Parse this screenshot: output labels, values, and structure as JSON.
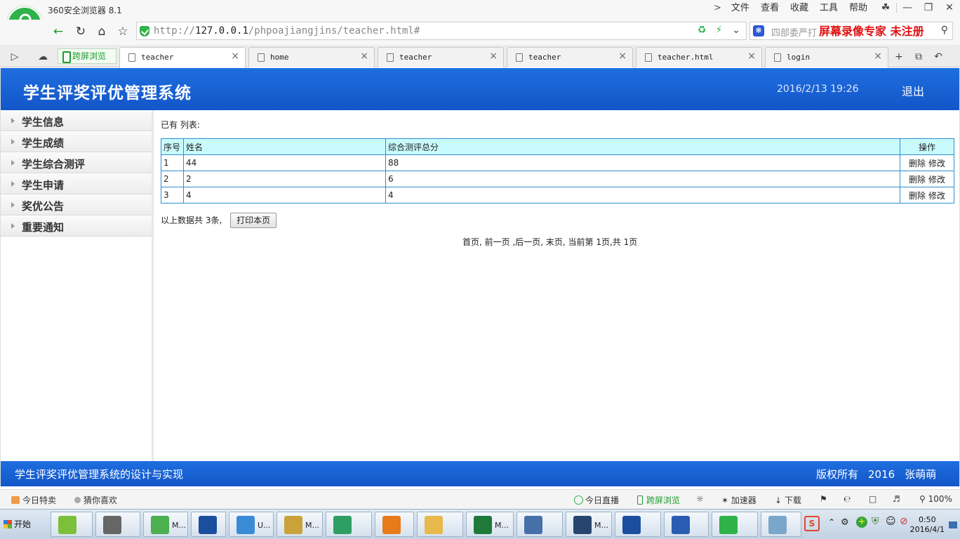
{
  "browser": {
    "app_title": "360安全浏览器 8.1",
    "menu": [
      "文件",
      "查看",
      "收藏",
      "工具",
      "帮助"
    ],
    "url_prefix": "http://",
    "url_host": "127.0.0.1",
    "url_path": "/phpoajiangjins/teacher.html#",
    "search_placeholder": "四部委严打",
    "watermark": "屏幕录像专家 未注册",
    "cross_screen": "跨屏浏览",
    "tabs": [
      {
        "label": "teacher",
        "active": true
      },
      {
        "label": "home",
        "active": false
      },
      {
        "label": "teacher",
        "active": false
      },
      {
        "label": "teacher",
        "active": false
      },
      {
        "label": "teacher.html",
        "active": false
      },
      {
        "label": "login",
        "active": false
      }
    ]
  },
  "header": {
    "title": "学生评奖评优管理系统",
    "datetime": "2016/2/13 19:26",
    "logout": "退出"
  },
  "sidebar": {
    "items": [
      "学生信息",
      "学生成绩",
      "学生综合测评",
      "学生申请",
      "奖优公告",
      "重要通知"
    ]
  },
  "main": {
    "list_header": "已有 列表:",
    "columns": [
      "序号",
      "姓名",
      "综合测评总分",
      "操作"
    ],
    "rows": [
      {
        "no": "1",
        "name": "44",
        "score": "88"
      },
      {
        "no": "2",
        "name": "2",
        "score": "6"
      },
      {
        "no": "3",
        "name": "4",
        "score": "4"
      }
    ],
    "delete_label": "删除",
    "edit_label": "修改",
    "summary": "以上数据共 3条,",
    "print_button": "打印本页",
    "pager": "首页, 前一页 ,后一页, 末页, 当前第 1页,共 1页"
  },
  "footer": {
    "title": "学生评奖评优管理系统的设计与实现",
    "copyright": "版权所有",
    "year": "2016",
    "author": "张萌萌"
  },
  "statusbar": {
    "left": [
      "今日特卖",
      "猜你喜欢"
    ],
    "right": [
      "今日直播",
      "跨屏浏览",
      "加速器",
      "下载"
    ],
    "zoom": "100%"
  },
  "taskbar": {
    "start": "开始",
    "items": [
      {
        "icon": "android-icon",
        "label": "",
        "color": "#7bbf3a"
      },
      {
        "icon": "camera-icon",
        "label": "",
        "color": "#666666"
      },
      {
        "icon": "dreamweaver-icon",
        "label": "M...",
        "color": "#4caf50"
      },
      {
        "icon": "photoshop-icon",
        "label": "",
        "color": "#1b4f9e"
      },
      {
        "icon": "transfer-icon",
        "label": "U...",
        "color": "#3a8ad6"
      },
      {
        "icon": "tools-icon",
        "label": "M...",
        "color": "#c9a23a"
      },
      {
        "icon": "globe-icon",
        "label": "",
        "color": "#2e9e64"
      },
      {
        "icon": "database-icon",
        "label": "",
        "color": "#e77b1a"
      },
      {
        "icon": "folder-icon",
        "label": "",
        "color": "#e7b84a"
      },
      {
        "icon": "excel-icon",
        "label": "M...",
        "color": "#1f7a3a"
      },
      {
        "icon": "computer-icon",
        "label": "",
        "color": "#4670a8"
      },
      {
        "icon": "editor-icon",
        "label": "M...",
        "color": "#27456e"
      },
      {
        "icon": "photoshop-icon",
        "label": "",
        "color": "#1b4f9e"
      },
      {
        "icon": "word-icon",
        "label": "",
        "color": "#2a5cb3"
      },
      {
        "icon": "browser360-icon",
        "label": "",
        "color": "#2fb24a"
      },
      {
        "icon": "notepad-icon",
        "label": "",
        "color": "#7aa7c9"
      }
    ],
    "time": "0:50",
    "date": "2016/4/1"
  }
}
